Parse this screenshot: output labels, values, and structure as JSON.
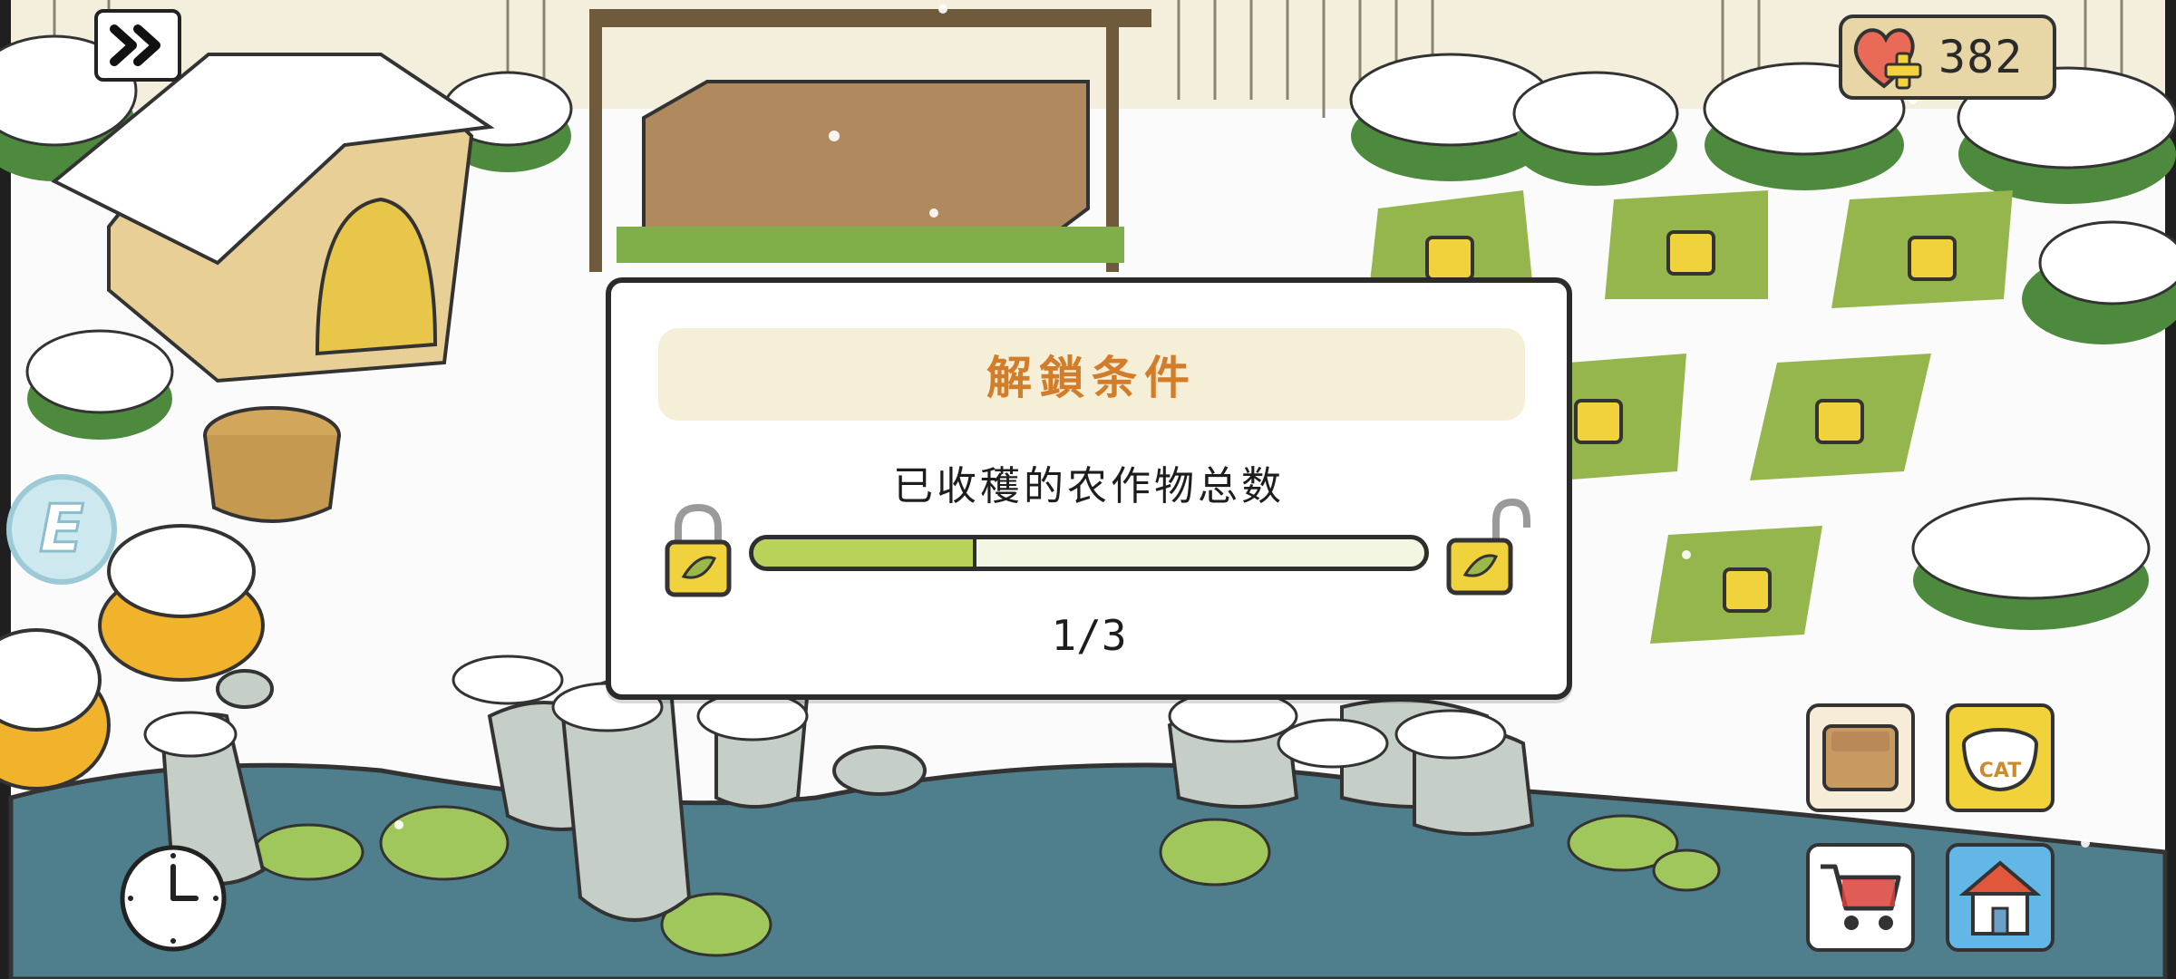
{
  "hud": {
    "hearts_count": "382",
    "skip_icon": "double-chevron-right-icon",
    "heart_icon": "heart-plus-icon",
    "food_bowl_label": "CAT"
  },
  "unlock_dialog": {
    "title": "解鎖条件",
    "requirement": "已收穫的农作物总数",
    "progress_text": "1/3",
    "progress_value": 0.333,
    "lock_left_icon": "padlock-closed-icon",
    "lock_right_icon": "padlock-open-icon"
  },
  "colors": {
    "title": "#d37d2a",
    "progress_fill": "#b9d35a",
    "header_bg": "#f6efd8",
    "snow": "#ffffff",
    "grass": "#7fae4b",
    "pond": "#4f7f8c"
  }
}
